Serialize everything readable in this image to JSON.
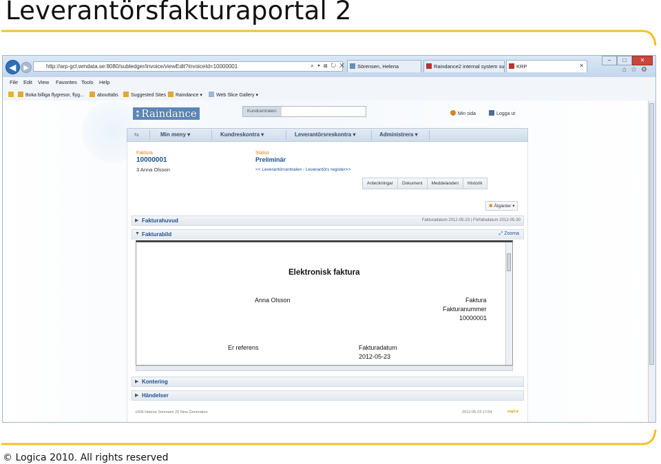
{
  "slide": {
    "title": "Leverantörsfakturaportal 2",
    "footer": "© Logica 2010. All rights reserved"
  },
  "colors": {
    "accent_rule": "#f2c028",
    "link_blue": "#1d4f90",
    "label_orange": "#e07b12"
  },
  "browser": {
    "url": "http://arp-gcl.wmdata.se:8080/subledger/invoice/viewEdit?invoiceId=10000001",
    "tabs": [
      {
        "label": "Sörensen, Helena"
      },
      {
        "label": "Raindance2 internal system su..."
      },
      {
        "label": "KRP"
      }
    ],
    "window_controls": {
      "minimize": "–",
      "maximize": "□",
      "close": "✕"
    },
    "menu": [
      "File",
      "Edit",
      "View",
      "Favorites",
      "Tools",
      "Help"
    ],
    "favorites": [
      "Boka billiga flygresor, flyg...",
      "abouttabs",
      "Suggested Sites",
      "Raindance",
      "Web Slice Gallery"
    ]
  },
  "app": {
    "logo": "Raindance",
    "search_label": "Kundcentralen:",
    "top_links": {
      "my_page": "Min sida",
      "logout": "Logga ut"
    },
    "nav": [
      "Min meny",
      "Kundreskontra",
      "Leverantörsreskontra",
      "Administrera"
    ],
    "invoice": {
      "label": "Faktura",
      "number": "10000001",
      "supplier": "3 Anna Olsson",
      "status_label": "Status",
      "status": "Preliminär",
      "breadcrumb": "<< Leverantörcentralen - Leverantörs register>>"
    },
    "action_tabs": [
      "Anteckningar",
      "Dokument",
      "Meddelanden",
      "Historik"
    ],
    "actions_button": "Åtgärder",
    "sections": {
      "header": "Fakturahuvud",
      "header_dates": "Fakturadatum  2012-05-23  |  Förfallodatum  2012-05-30",
      "image": "Fakturabild",
      "zoom": "Zooma",
      "accounting": "Kontering",
      "events": "Händelser"
    },
    "document": {
      "title": "Elektronisk faktura",
      "name": "Anna Olsson",
      "doc_type": "Faktura",
      "number_label": "Fakturanummer",
      "number": "10000001",
      "reference_label": "Er referens",
      "date_label": "Fakturadatum",
      "date": "2012-05-23"
    },
    "status_bar": {
      "left": "HSN   Helena Sörensen   26   New Generation",
      "right": "2012-05-23 17:54",
      "brand": "logica"
    }
  }
}
